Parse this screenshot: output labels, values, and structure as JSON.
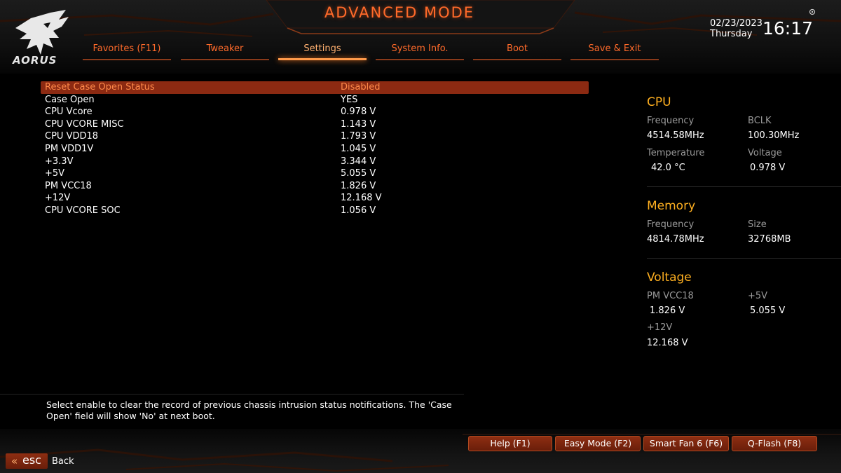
{
  "header": {
    "mode_title": "ADVANCED MODE",
    "logo_text": "AORUS",
    "date": "02/23/2023",
    "day": "Thursday",
    "time": "16:17",
    "accent_color": "#ff6a2a"
  },
  "tabs": [
    {
      "label": "Favorites (F11)",
      "active": false
    },
    {
      "label": "Tweaker",
      "active": false
    },
    {
      "label": "Settings",
      "active": true
    },
    {
      "label": "System Info.",
      "active": false
    },
    {
      "label": "Boot",
      "active": false
    },
    {
      "label": "Save & Exit",
      "active": false
    }
  ],
  "settings": [
    {
      "label": "Reset Case Open Status",
      "value": "Disabled",
      "selected": true
    },
    {
      "label": "Case Open",
      "value": "YES"
    },
    {
      "label": "CPU Vcore",
      "value": "0.978 V"
    },
    {
      "label": "CPU VCORE MISC",
      "value": "1.143 V"
    },
    {
      "label": "CPU VDD18",
      "value": "1.793 V"
    },
    {
      "label": "PM VDD1V",
      "value": "1.045 V"
    },
    {
      "label": "+3.3V",
      "value": "3.344 V"
    },
    {
      "label": "+5V",
      "value": "5.055 V"
    },
    {
      "label": "PM VCC18",
      "value": "1.826 V"
    },
    {
      "label": "+12V",
      "value": "12.168 V"
    },
    {
      "label": "CPU VCORE SOC",
      "value": "1.056 V"
    }
  ],
  "info": {
    "cpu": {
      "title": "CPU",
      "frequency_label": "Frequency",
      "frequency": "4514.58MHz",
      "bclk_label": "BCLK",
      "bclk": "100.30MHz",
      "temperature_label": "Temperature",
      "temperature": "42.0 °C",
      "voltage_label": "Voltage",
      "voltage": "0.978 V"
    },
    "memory": {
      "title": "Memory",
      "frequency_label": "Frequency",
      "frequency": "4814.78MHz",
      "size_label": "Size",
      "size": "32768MB"
    },
    "voltage": {
      "title": "Voltage",
      "pm_vcc18_label": "PM VCC18",
      "pm_vcc18": "1.826 V",
      "p5v_label": "+5V",
      "p5v": "5.055 V",
      "p12v_label": "+12V",
      "p12v": "12.168 V"
    }
  },
  "help_text": "Select enable to clear the record of previous chassis intrusion status notifications. The 'Case Open' field will show 'No' at next boot.",
  "footer": {
    "buttons": [
      "Help (F1)",
      "Easy Mode (F2)",
      "Smart Fan 6 (F6)",
      "Q-Flash (F8)"
    ],
    "esc_label": "esc",
    "back_label": "Back"
  }
}
